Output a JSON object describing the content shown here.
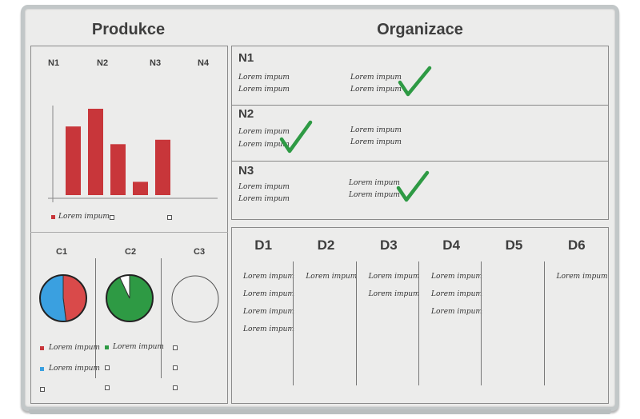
{
  "headers": {
    "left": "Produkce",
    "right": "Organizace"
  },
  "produkce": {
    "chart_columns": [
      "N1",
      "N2",
      "N3",
      "N4"
    ],
    "chart_data": {
      "type": "bar",
      "values": [
        0.62,
        0.78,
        0.46,
        0.12,
        0.5
      ],
      "color": "#c8363a",
      "legend": "Lorem impum"
    },
    "pies": {
      "labels": [
        "C1",
        "C2",
        "C3"
      ],
      "c1": {
        "fractions": [
          0.48,
          0.52
        ],
        "colors": [
          "#d94a4a",
          "#3aa0e0"
        ],
        "legend": [
          "Lorem impum",
          "Lorem impum"
        ]
      },
      "c2": {
        "fractions": [
          0.93,
          0.07
        ],
        "colors": [
          "#2e9a44",
          "#ffffff"
        ],
        "legend": [
          "Lorem impum"
        ]
      }
    }
  },
  "organizace": {
    "rows": [
      {
        "label": "N1",
        "col1": [
          "Lorem impum",
          "Lorem impum"
        ],
        "col2": [
          "Lorem impum",
          "Lorem impum"
        ],
        "check": "col2"
      },
      {
        "label": "N2",
        "col1": [
          "Lorem impum",
          "Lorem impum"
        ],
        "col2": [
          "Lorem impum",
          "Lorem impum"
        ],
        "check": "col1"
      },
      {
        "label": "N3",
        "col1": [
          "Lorem impum",
          "Lorem impum"
        ],
        "col2": [
          "Lorem impum",
          "Lorem impum"
        ],
        "check": "col2"
      }
    ],
    "check_color": "#2e9a44",
    "d_columns": [
      {
        "label": "D1",
        "items": [
          "Lorem impum",
          "Lorem impum",
          "Lorem impum",
          "Lorem impum"
        ]
      },
      {
        "label": "D2",
        "items": [
          "Lorem impum"
        ]
      },
      {
        "label": "D3",
        "items": [
          "Lorem impum",
          "Lorem impum"
        ]
      },
      {
        "label": "D4",
        "items": [
          "Lorem impum",
          "Lorem impum",
          "Lorem impum"
        ]
      },
      {
        "label": "D5",
        "items": []
      },
      {
        "label": "D6",
        "items": [
          "Lorem impum"
        ]
      }
    ]
  }
}
